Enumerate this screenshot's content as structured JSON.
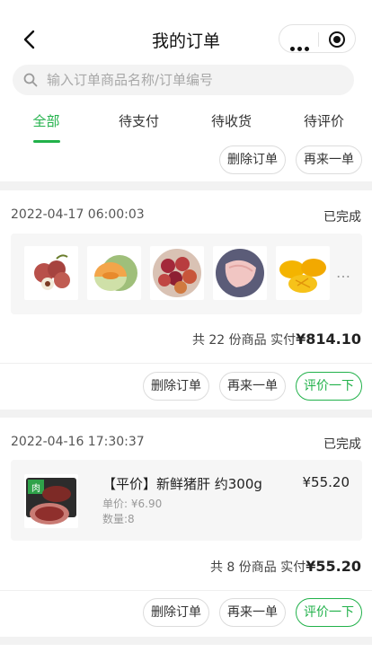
{
  "header": {
    "title": "我的订单"
  },
  "search": {
    "placeholder": "输入订单商品名称/订单编号"
  },
  "tabs": [
    {
      "label": "全部",
      "active": true
    },
    {
      "label": "待支付"
    },
    {
      "label": "待收货"
    },
    {
      "label": "待评价"
    }
  ],
  "prev_order": {
    "delete_label": "删除订单",
    "reorder_label": "再来一单"
  },
  "orders": [
    {
      "date": "2022-04-17 06:00:03",
      "status": "已完成",
      "thumbs": [
        "lychee",
        "cantaloupe",
        "plums",
        "chicken",
        "mango"
      ],
      "more": "…",
      "summary_prefix": "共 22 份商品  实付",
      "total": "¥814.10",
      "delete_label": "删除订单",
      "reorder_label": "再来一单",
      "review_label": "评价一下"
    },
    {
      "date": "2022-04-16 17:30:37",
      "status": "已完成",
      "item": {
        "name": "【平价】新鲜猪肝 约300g",
        "price": "¥55.20",
        "unit_price": "单价: ¥6.90",
        "qty": "数量:8"
      },
      "summary_prefix": "共 8 份商品  实付",
      "total": "¥55.20",
      "delete_label": "删除订单",
      "reorder_label": "再来一单",
      "review_label": "评价一下"
    }
  ],
  "colors": {
    "accent": "#21b14a",
    "background": "#f2f2f2"
  }
}
